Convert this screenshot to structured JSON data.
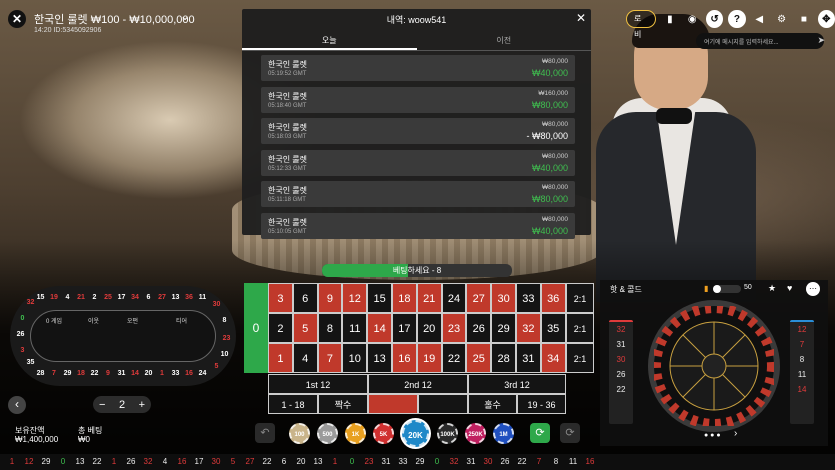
{
  "header": {
    "game_title": "한국인 룰렛 ₩100 - ₩10,000,000",
    "game_id": "14:20  ID:5345092906"
  },
  "history": {
    "title": "내역: woow541",
    "tabs": [
      "오늘",
      "이전"
    ],
    "rows": [
      {
        "name": "한국인 룰렛",
        "time": "05:19:52 GMT",
        "bet": "₩80,000",
        "win": "₩40,000"
      },
      {
        "name": "한국인 룰렛",
        "time": "05:18:40 GMT",
        "bet": "₩160,000",
        "win": "₩80,000"
      },
      {
        "name": "한국인 룰렛",
        "time": "05:18:03 GMT",
        "bet": "₩80,000",
        "win": "- ₩80,000"
      },
      {
        "name": "한국인 룰렛",
        "time": "05:12:33 GMT",
        "bet": "₩80,000",
        "win": "₩40,000"
      },
      {
        "name": "한국인 룰렛",
        "time": "05:11:18 GMT",
        "bet": "₩80,000",
        "win": "₩80,000"
      },
      {
        "name": "한국인 룰렛",
        "time": "05:10:05 GMT",
        "bet": "₩80,000",
        "win": "₩40,000"
      }
    ]
  },
  "top_right": {
    "lobby_label": "로비",
    "chat_placeholder": "여기에 메시지를 입력하세요..."
  },
  "betting": {
    "banner": "베팅하세요 - 8",
    "progress": 0.45,
    "zero": "0",
    "column_label": "2:1",
    "dozens": [
      "1st 12",
      "2nd 12",
      "3rd 12"
    ],
    "outside": [
      "1 - 18",
      "짝수",
      "",
      "홀수",
      "19 - 36"
    ],
    "numbers": [
      [
        3,
        6,
        9,
        12,
        15,
        18,
        21,
        24,
        27,
        30,
        33,
        36
      ],
      [
        2,
        5,
        8,
        11,
        14,
        17,
        20,
        23,
        26,
        29,
        32,
        35
      ],
      [
        1,
        4,
        7,
        10,
        13,
        16,
        19,
        22,
        25,
        28,
        31,
        34
      ]
    ],
    "reds": [
      1,
      3,
      5,
      7,
      9,
      12,
      14,
      16,
      18,
      19,
      21,
      23,
      25,
      27,
      30,
      32,
      34,
      36
    ]
  },
  "racetrack": {
    "labels": [
      "0 게임",
      "이웃",
      "오펀",
      "티어"
    ],
    "top": [
      15,
      19,
      4,
      21,
      2,
      25,
      17,
      34,
      6,
      27,
      13,
      36,
      11
    ],
    "bottom": [
      28,
      7,
      29,
      18,
      22,
      9,
      31,
      14,
      20,
      1,
      33,
      16,
      24
    ],
    "left": [
      32,
      0,
      26,
      3,
      35,
      12
    ],
    "right": [
      30,
      8,
      23,
      10,
      5
    ]
  },
  "controls": {
    "stepper_value": "2",
    "balance_label": "보유잔액",
    "balance_value": "₩1,400,000",
    "total_label": "총 베팅",
    "total_value": "₩0"
  },
  "chips": [
    {
      "label": "100",
      "color": "#c9b48a"
    },
    {
      "label": "500",
      "color": "#9a9a9a"
    },
    {
      "label": "1K",
      "color": "#e8a020"
    },
    {
      "label": "5K",
      "color": "#d03030"
    },
    {
      "label": "20K",
      "color": "#1e88c8"
    },
    {
      "label": "100K",
      "color": "#2a2a2a"
    },
    {
      "label": "250K",
      "color": "#c02060"
    },
    {
      "label": "1M",
      "color": "#2050c0"
    }
  ],
  "hot_cold": {
    "title": "핫 & 콜드",
    "slider_value": "50",
    "hot": [
      "32",
      "31",
      "30",
      "26",
      "22"
    ],
    "cold": [
      "12",
      "7",
      "8",
      "11",
      "14"
    ]
  },
  "results": [
    "1",
    "12",
    "29",
    "0",
    "13",
    "22",
    "1",
    "26",
    "32",
    "4",
    "16",
    "17",
    "30",
    "5",
    "27",
    "22",
    "6",
    "20",
    "13",
    "1",
    "0",
    "23",
    "31",
    "33",
    "29",
    "0",
    "32",
    "31",
    "30",
    "26",
    "22",
    "7",
    "8",
    "11",
    "16"
  ]
}
